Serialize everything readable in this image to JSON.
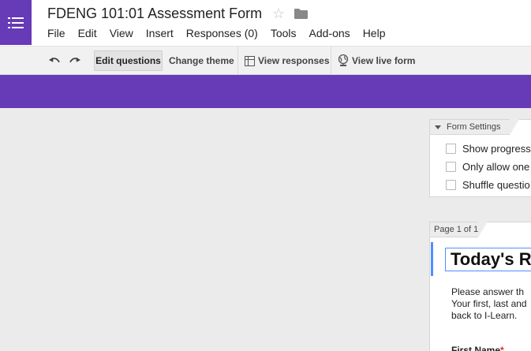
{
  "app": {
    "icon": "forms-list-icon"
  },
  "document": {
    "title": "FDENG 101:01 Assessment Form"
  },
  "menu": {
    "items": [
      "File",
      "Edit",
      "View",
      "Insert",
      "Responses (0)",
      "Tools",
      "Add-ons",
      "Help"
    ]
  },
  "toolbar": {
    "edit_questions": "Edit questions",
    "change_theme": "Change theme",
    "view_responses": "View responses",
    "view_live_form": "View live form"
  },
  "form_settings": {
    "header": "Form Settings",
    "options": [
      "Show progress",
      "Only allow one",
      "Shuffle questio"
    ]
  },
  "page": {
    "label": "Page 1 of 1",
    "form_title": "Today's R",
    "description": [
      "Please answer th",
      "Your first, last and",
      "back to I-Learn."
    ],
    "field_label": "First Name",
    "required_mark": "*"
  },
  "colors": {
    "theme": "#673ab7",
    "accent": "#4d90fe"
  }
}
